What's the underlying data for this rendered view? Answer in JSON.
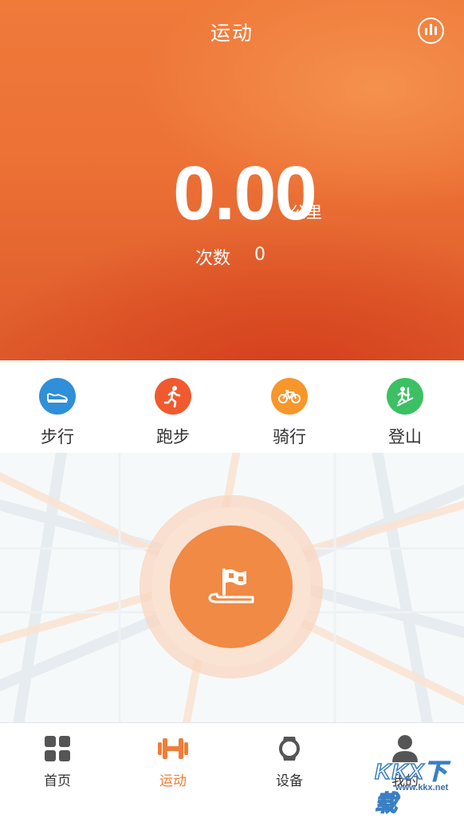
{
  "header": {
    "title": "运动",
    "distance": "0.00",
    "distance_unit": "公里",
    "count_label": "次数",
    "count_value": "0",
    "stats_icon": "bar-chart-icon"
  },
  "modes": [
    {
      "label": "步行",
      "icon": "shoe-icon",
      "color": "#2F8FD8",
      "selected": true
    },
    {
      "label": "跑步",
      "icon": "runner-icon",
      "color": "#F05A2E",
      "selected": false
    },
    {
      "label": "骑行",
      "icon": "bicycle-icon",
      "color": "#F7962A",
      "selected": false
    },
    {
      "label": "登山",
      "icon": "climber-icon",
      "color": "#3CC063",
      "selected": false
    }
  ],
  "start_button": {
    "icon": "flag-icon",
    "color": "#F08A45"
  },
  "bottom_nav": [
    {
      "label": "首页",
      "icon": "grid-icon",
      "active": false
    },
    {
      "label": "运动",
      "icon": "dumbbell-icon",
      "active": true
    },
    {
      "label": "设备",
      "icon": "watch-icon",
      "active": false
    },
    {
      "label": "我的",
      "icon": "person-icon",
      "active": false
    }
  ],
  "watermark": {
    "text": "KKX下载",
    "url": "www.kkx.net"
  },
  "colors": {
    "accent": "#F07D39",
    "header_top": "#EF7A3A",
    "header_bottom": "#D8462A"
  }
}
